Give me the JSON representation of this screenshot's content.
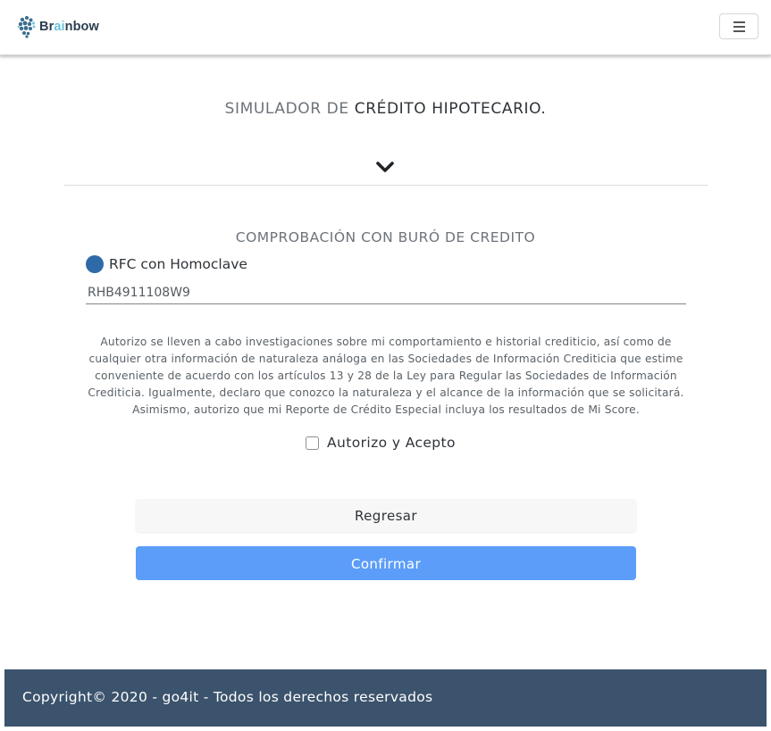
{
  "navbar": {
    "brand": {
      "prefix": "Br",
      "accent": "ai",
      "suffix": "nbow"
    },
    "menu_icon": "hamburger-icon"
  },
  "page": {
    "title_light": "SIMULADOR DE ",
    "title_strong": "CRÉDITO HIPOTECARIO.",
    "chevron_icon": "chevron-down-icon",
    "section_title": "COMPROBACIÓN CON BURÓ DE CREDITO"
  },
  "form": {
    "radio_label": "RFC con Homoclave",
    "rfc_value": "RHB4911108W9",
    "legal_lines": [
      "Autorizo se lleven a cabo investigaciones sobre mi comportamiento e historial crediticio, así como de",
      "cualquier otra información de naturaleza análoga en las Sociedades de Información Crediticia que estime",
      "conveniente de acuerdo con los artículos 13 y 28 de la Ley para Regular las Sociedades de Información",
      "Crediticia. Igualmente, declaro que conozco la naturaleza y el alcance de la información que se solicitará.",
      "Asimismo, autorizo que mi Reporte de Crédito Especial incluya los resultados de Mi Score."
    ],
    "checkbox_label": "Autorizo y Acepto",
    "checkbox_checked": false
  },
  "buttons": {
    "back_label": "Regresar",
    "confirm_label": "Confirmar"
  },
  "footer": {
    "text": "Copyright© 2020 - go4it - Todos los derechos reservados"
  },
  "colors": {
    "accent": "#5b9df9",
    "radio": "#2f6aa8",
    "footer_bg": "#3b536c",
    "brand_text": "#2c3e50"
  }
}
